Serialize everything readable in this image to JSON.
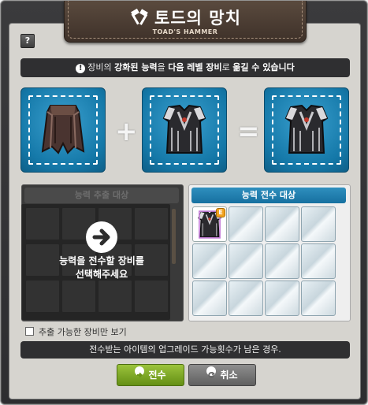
{
  "window": {
    "title": "토드의 망치",
    "subtitle": "TOAD'S HAMMER",
    "title_icon": "hammer-icon",
    "help_label": "?"
  },
  "notice": {
    "icon": "exclamation-icon",
    "text_parts": [
      "장비의 ",
      "강화된 능력",
      "을 ",
      "다음 레벨 장비",
      "로 ",
      "옮길 수 있습니다"
    ]
  },
  "formula": {
    "slots": [
      "source-item",
      "target-item",
      "result-item"
    ],
    "plus": "+",
    "equals": "="
  },
  "left_panel": {
    "header": "능력 추출 대상",
    "prompt_line1": "능력을 전수할 장비를",
    "prompt_line2": "선택해주세요",
    "arrow_icon": "arrow-right-icon"
  },
  "right_panel": {
    "header": "능력 전수 대상",
    "badge": "E"
  },
  "filter": {
    "label": "추출 가능한 장비만 보기",
    "checked": false
  },
  "info": {
    "text": "전수받는 아이템의 업그레이드 가능횟수가 남은 경우."
  },
  "buttons": {
    "confirm": "전수",
    "cancel": "취소"
  },
  "colors": {
    "accent_blue": "#1a7fb0",
    "confirm_green": "#7aa82a",
    "banner_brown": "#4a3b31"
  }
}
